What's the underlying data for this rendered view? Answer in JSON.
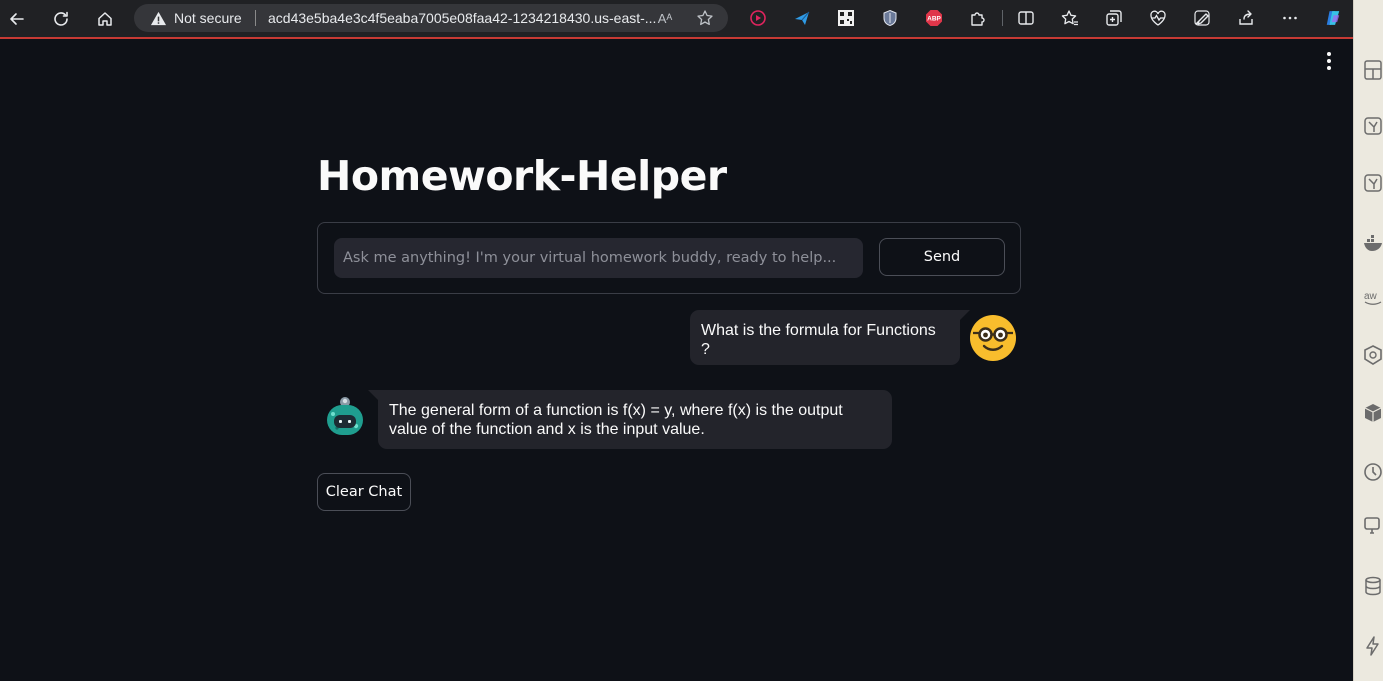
{
  "browser": {
    "security_label": "Not secure",
    "url": "acd43e5ba4e3c4f5eaba7005e08faa42-1234218430.us-east-...",
    "read_aloud_glyph": "Aᴬ",
    "icons": [
      "back-icon",
      "refresh-icon",
      "home-icon",
      "warning-icon",
      "read-aloud-icon",
      "favorite-star-icon"
    ],
    "extensions": [
      "screen-recorder-icon",
      "paper-plane-icon",
      "qr-code-icon",
      "shield-icon",
      "adblock-icon",
      "puzzle-extensions-icon",
      "split-screen-icon",
      "favorites-icon",
      "collections-icon",
      "browser-essentials-icon",
      "performance-icon",
      "share-icon",
      "more-icon",
      "copilot-icon"
    ],
    "adblock_label": "ABP"
  },
  "side_panel": {
    "icons": [
      "layout-icon",
      "leaf-icon",
      "leaf-icon-2",
      "docker-icon",
      "aws-icon",
      "kubernetes-icon",
      "box-icon",
      "clock-icon",
      "device-icon",
      "database-icon",
      "bolt-icon"
    ]
  },
  "app": {
    "title": "Homework-Helper",
    "input": {
      "placeholder": "Ask me anything! I'm your virtual homework buddy, ready to help...",
      "value": ""
    },
    "send_label": "Send",
    "messages": [
      {
        "role": "user",
        "text": "What is the formula for Functions ?"
      },
      {
        "role": "bot",
        "text": "The general form of a function is f(x) = y, where f(x) is the output value of the function and x is the input value."
      }
    ],
    "clear_label": "Clear Chat"
  },
  "colors": {
    "background": "#0e1117",
    "bubble": "#23242b",
    "input_bg": "#262730",
    "accent_red": "#c73a34"
  }
}
